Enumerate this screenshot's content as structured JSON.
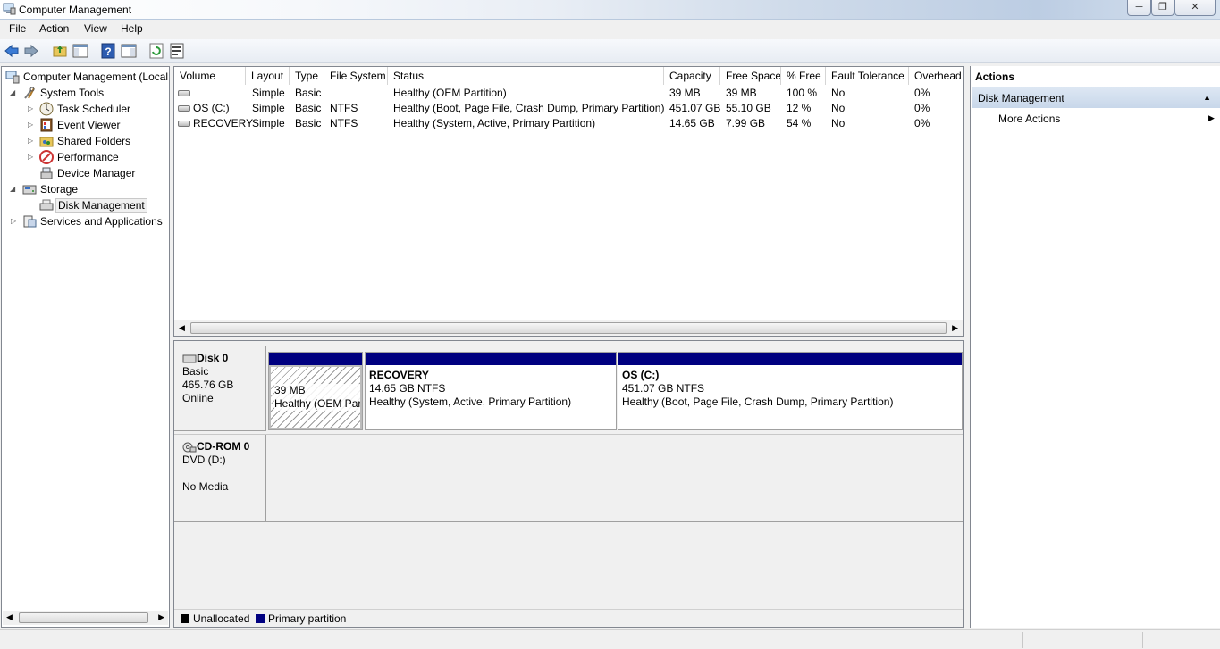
{
  "window": {
    "title": "Computer Management"
  },
  "menu": {
    "items": [
      "File",
      "Action",
      "View",
      "Help"
    ]
  },
  "tree": {
    "root": "Computer Management (Local",
    "system_tools": "System Tools",
    "task_scheduler": "Task Scheduler",
    "event_viewer": "Event Viewer",
    "shared_folders": "Shared Folders",
    "performance": "Performance",
    "device_manager": "Device Manager",
    "storage": "Storage",
    "disk_management": "Disk Management",
    "services": "Services and Applications"
  },
  "volumes": {
    "columns": [
      "Volume",
      "Layout",
      "Type",
      "File System",
      "Status",
      "Capacity",
      "Free Space",
      "% Free",
      "Fault Tolerance",
      "Overhead"
    ],
    "rows": [
      [
        "",
        "Simple",
        "Basic",
        "",
        "Healthy (OEM Partition)",
        "39 MB",
        "39 MB",
        "100 %",
        "No",
        "0%"
      ],
      [
        "OS (C:)",
        "Simple",
        "Basic",
        "NTFS",
        "Healthy (Boot, Page File, Crash Dump, Primary Partition)",
        "451.07 GB",
        "55.10 GB",
        "12 %",
        "No",
        "0%"
      ],
      [
        "RECOVERY",
        "Simple",
        "Basic",
        "NTFS",
        "Healthy (System, Active, Primary Partition)",
        "14.65 GB",
        "7.99 GB",
        "54 %",
        "No",
        "0%"
      ]
    ]
  },
  "disk0": {
    "name": "Disk 0",
    "type": "Basic",
    "size": "465.76 GB",
    "state": "Online",
    "partitions": {
      "oem": {
        "size": "39 MB",
        "status": "Healthy (OEM Par"
      },
      "recovery": {
        "name": "RECOVERY",
        "size": "14.65 GB NTFS",
        "status": "Healthy (System, Active, Primary Partition)"
      },
      "os": {
        "name": "OS  (C:)",
        "size": "451.07 GB NTFS",
        "status": "Healthy (Boot, Page File, Crash Dump, Primary Partition)"
      }
    }
  },
  "cdrom0": {
    "name": "CD-ROM 0",
    "type": "DVD (D:)",
    "state": "No Media"
  },
  "legend": {
    "unallocated": "Unallocated",
    "primary": "Primary partition",
    "unallocated_color": "#000000",
    "primary_color": "#000080"
  },
  "actions": {
    "title": "Actions",
    "section": "Disk Management",
    "more": "More Actions"
  }
}
